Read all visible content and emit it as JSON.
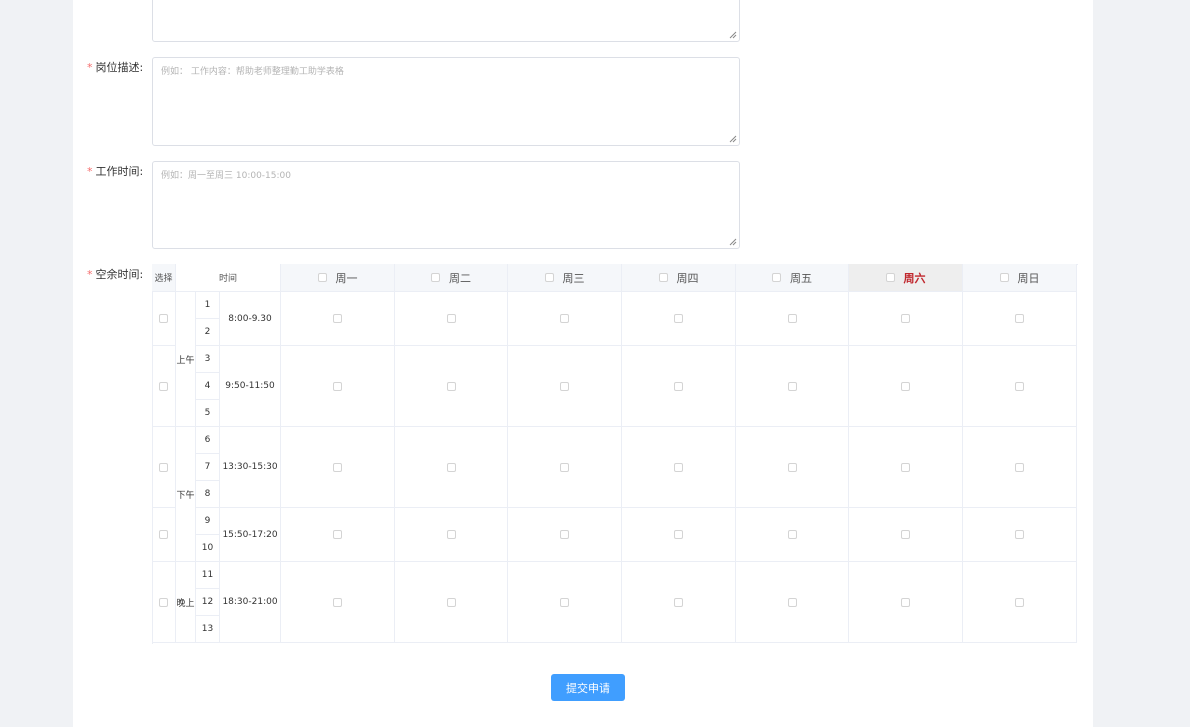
{
  "form": {
    "description": {
      "label": "岗位描述:",
      "placeholder": "例如： 工作内容：帮助老师整理勤工助学表格"
    },
    "work_time": {
      "label": "工作时间:",
      "placeholder": "例如：周一至周三 10:00-15:00"
    },
    "free_time": {
      "label": "空余时间:"
    },
    "required_mark": "*"
  },
  "schedule": {
    "col_select": "选择",
    "col_time": "时间",
    "days": [
      "周一",
      "周二",
      "周三",
      "周四",
      "周五",
      "周六",
      "周日"
    ],
    "highlighted_day": "周六",
    "periods": [
      "上午",
      "下午",
      "晚上"
    ],
    "numbers": [
      "1",
      "2",
      "3",
      "4",
      "5",
      "6",
      "7",
      "8",
      "9",
      "10",
      "11",
      "12",
      "13"
    ],
    "ranges": [
      "8:00-9.30",
      "9:50-11:50",
      "13:30-15:30",
      "15:50-17:20",
      "18:30-21:00"
    ]
  },
  "submit_label": "提交申请",
  "colors": {
    "accent": "#409eff",
    "required": "#f56c6c",
    "highlight_day": "#c0272d"
  }
}
